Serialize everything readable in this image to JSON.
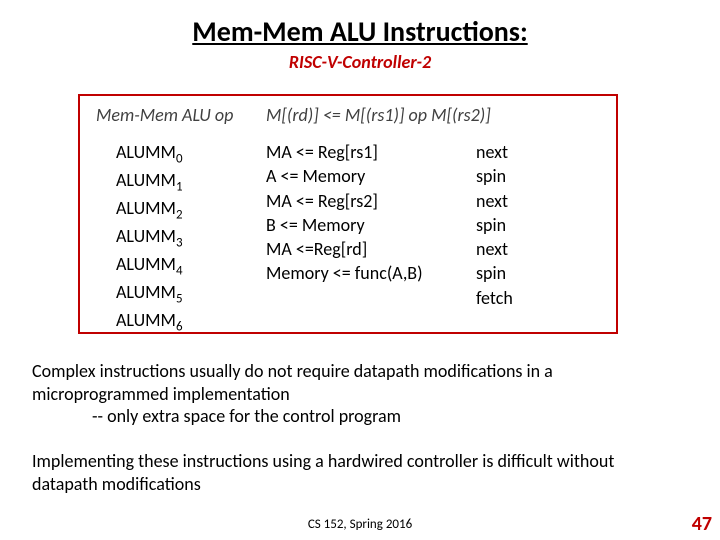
{
  "title": "Mem-Mem ALU Instructions:",
  "subtitle": "RISC-V-Controller-2",
  "box_header": {
    "left": "Mem-Mem ALU op",
    "right": "M[(rd)] <= M[(rs1)] op M[(rs2)]"
  },
  "states": [
    {
      "name_base": "ALUMM",
      "name_sub": "0",
      "action": "MA <= Reg[rs1]",
      "next": "next"
    },
    {
      "name_base": "ALUMM",
      "name_sub": "1",
      "action": "A   <= Memory",
      "next": "spin"
    },
    {
      "name_base": "ALUMM",
      "name_sub": "2",
      "action": "MA <= Reg[rs2]",
      "next": "next"
    },
    {
      "name_base": "ALUMM",
      "name_sub": "3",
      "action": "B   <= Memory",
      "next": "spin"
    },
    {
      "name_base": "ALUMM",
      "name_sub": "4",
      "action": "MA <=Reg[rd]",
      "next": "next"
    },
    {
      "name_base": "ALUMM",
      "name_sub": "5",
      "action": "Memory <= func(A,B)",
      "next": "spin"
    },
    {
      "name_base": "ALUMM",
      "name_sub": "6",
      "action": "",
      "next": "fetch"
    }
  ],
  "paragraph1_line1": "Complex instructions usually do not require datapath modifications in a microprogrammed implementation",
  "paragraph1_line2": "-- only extra space for the control program",
  "paragraph2": "Implementing these instructions using a hardwired controller is difficult without datapath modifications",
  "footer": "CS 152, Spring 2016",
  "page_number": "47"
}
